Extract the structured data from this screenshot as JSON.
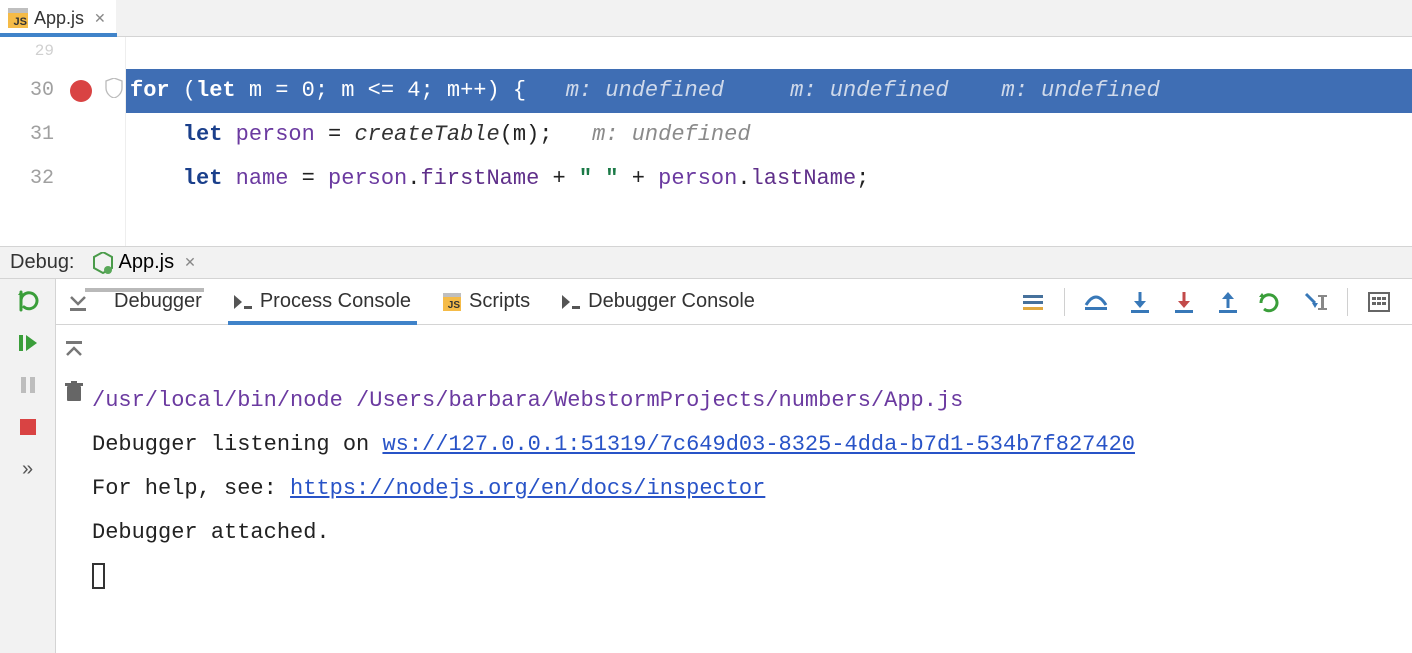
{
  "editor": {
    "tab": {
      "label": "App.js"
    },
    "gutter": {
      "l29": "29",
      "l30": "30",
      "l31": "31",
      "l32": "32"
    },
    "line30": {
      "kw_for": "for",
      "op1": " (",
      "kw_let": "let",
      "sp1": " ",
      "var_m": "m",
      "eq": " = ",
      "zero": "0",
      "semi1": "; ",
      "var_m2": "m",
      "lte": " <= ",
      "four": "4",
      "semi2": "; ",
      "var_m3": "m",
      "inc": "++) {",
      "hint1": "m: undefined",
      "hint2": "m: undefined",
      "hint3": "m: undefined"
    },
    "line31": {
      "indent": "    ",
      "kw_let": "let",
      "sp": " ",
      "var_person": "person",
      "eq": " = ",
      "fn": "createTable",
      "args": "(m);",
      "hint": "m: undefined"
    },
    "line32": {
      "indent": "    ",
      "kw_let": "let",
      "sp": " ",
      "var_name": "name",
      "eq": " = ",
      "p1": "person",
      "dot1": ".",
      "first": "firstName",
      "plus1": " + ",
      "str": "\" \"",
      "plus2": " + ",
      "p2": "person",
      "dot2": ".",
      "last": "lastName",
      "semi": ";"
    }
  },
  "debug": {
    "label": "Debug:",
    "config_name": "App.js",
    "tabs": {
      "debugger": "Debugger",
      "process_console": "Process Console",
      "scripts": "Scripts",
      "debugger_console": "Debugger Console"
    },
    "console": {
      "cmd": "/usr/local/bin/node /Users/barbara/WebstormProjects/numbers/App.js",
      "l2a": "Debugger listening on ",
      "l2link": "ws://127.0.0.1:51319/7c649d03-8325-4dda-b7d1-534b7f827420",
      "l3a": "For help, see: ",
      "l3link": "https://nodejs.org/en/docs/inspector",
      "l4": "Debugger attached."
    }
  }
}
